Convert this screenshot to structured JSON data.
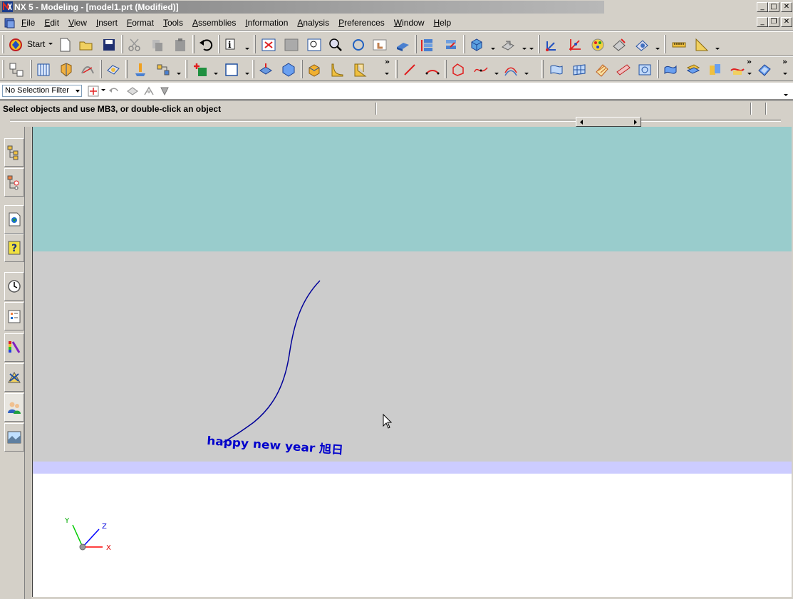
{
  "window": {
    "title": "NX 5 - Modeling - [model1.prt (Modified)]"
  },
  "menu": [
    "File",
    "Edit",
    "View",
    "Insert",
    "Format",
    "Tools",
    "Assemblies",
    "Information",
    "Analysis",
    "Preferences",
    "Window",
    "Help"
  ],
  "toolbar": {
    "start_label": "Start"
  },
  "selection_filter": {
    "value": "No Selection Filter"
  },
  "cue_line": {
    "text": "Select objects and use MB3, or double-click an object"
  },
  "graphics": {
    "annotation_text": "happy new year 旭日",
    "colors": {
      "upper_band": "#99cccc",
      "middle_band": "#cccccc",
      "stripe": "#ccccff",
      "lower_band": "#ffffff",
      "curve": "#000099",
      "text": "#0000cc"
    },
    "triad": {
      "x_label": "X",
      "y_label": "Y",
      "z_label": "Z"
    }
  },
  "resource_bar": [
    "assembly-navigator",
    "part-navigator",
    "web-browser",
    "help",
    "history",
    "reuse-library",
    "palette",
    "roles-tool",
    "roles",
    "system-visualization"
  ]
}
